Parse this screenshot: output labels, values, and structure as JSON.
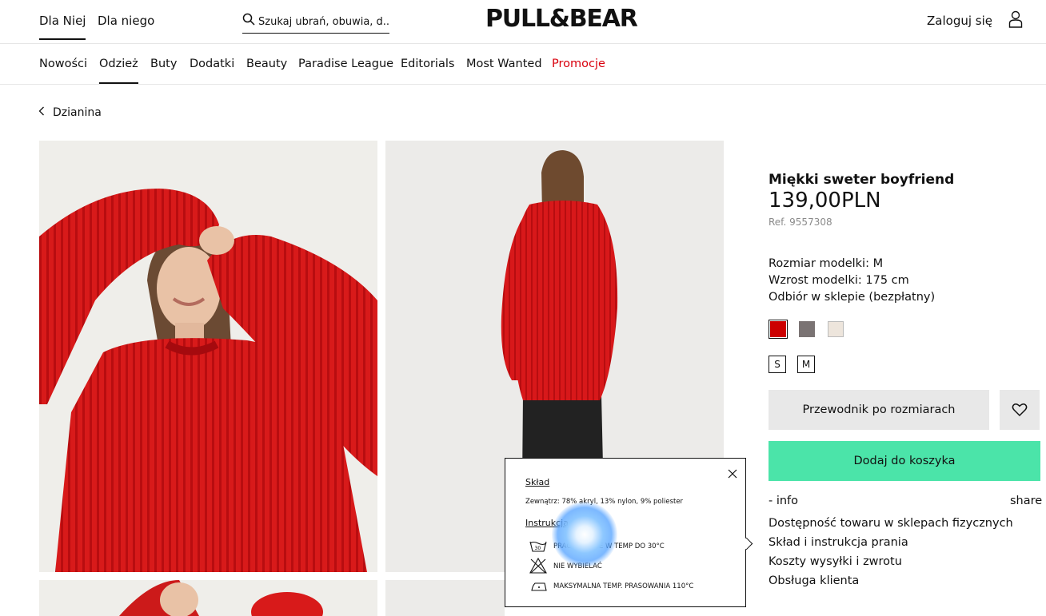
{
  "header": {
    "gender_tabs": [
      {
        "label": "Dla Niej",
        "active": true
      },
      {
        "label": "Dla niego",
        "active": false
      }
    ],
    "search_placeholder": "Szukaj ubrań, obuwia, d...",
    "logo": "PULL&BEAR",
    "login_label": "Zaloguj się",
    "icons": {
      "search": "search-icon",
      "user": "user-icon"
    }
  },
  "nav": {
    "items": [
      {
        "label": "Nowości"
      },
      {
        "label": "Odzież",
        "active": true
      },
      {
        "label": "Buty"
      },
      {
        "label": "Dodatki"
      },
      {
        "label": "Beauty"
      },
      {
        "label": "Paradise League"
      },
      {
        "label": "Editorials"
      },
      {
        "label": "Most Wanted"
      },
      {
        "label": "Promocje",
        "promo": true
      }
    ],
    "promo_color": "#d9000d"
  },
  "breadcrumb": {
    "label": "Dzianina",
    "icon": "chevron-left-icon"
  },
  "product": {
    "title": "Miękki sweter boyfriend",
    "price": "139,00PLN",
    "ref": "Ref. 9557308",
    "model_size": "Rozmiar modelki: M",
    "model_height": "Wzrost modelki: 175 cm",
    "pickup": "Odbiór w sklepie (bezpłatny)",
    "colors": [
      {
        "name": "red",
        "hex": "#cc0000",
        "selected": true
      },
      {
        "name": "grey",
        "hex": "#7a7373",
        "selected": false
      },
      {
        "name": "cream",
        "hex": "#ede5dc",
        "selected": false
      }
    ],
    "sizes": [
      "S",
      "M"
    ],
    "size_guide_label": "Przewodnik po rozmiarach",
    "add_to_cart_label": "Dodaj do koszyka",
    "accent_color": "#4be4a9",
    "info_label": "- info",
    "share_label": "share",
    "info_links": [
      "Dostępność towaru w sklepach fizycznych",
      "Skład i instrukcja prania",
      "Koszty wysyłki i zwrotu",
      "Obsługa klienta"
    ]
  },
  "popup": {
    "composition_title": "Skład",
    "composition_text": "Zewnątrz: 78% akryl, 13% nylon, 9% poliester",
    "instructions_title": "Instrukcja prania",
    "care": [
      {
        "icon": "wash-30-icon",
        "text": "PRAĆ RĘCZNIE W TEMP DO 30°C"
      },
      {
        "icon": "no-bleach-icon",
        "text": "NIE WYBIELAĆ"
      },
      {
        "icon": "iron-110-icon",
        "text": "MAKSYMALNA TEMP. PRASOWANIA 110°C"
      }
    ]
  }
}
